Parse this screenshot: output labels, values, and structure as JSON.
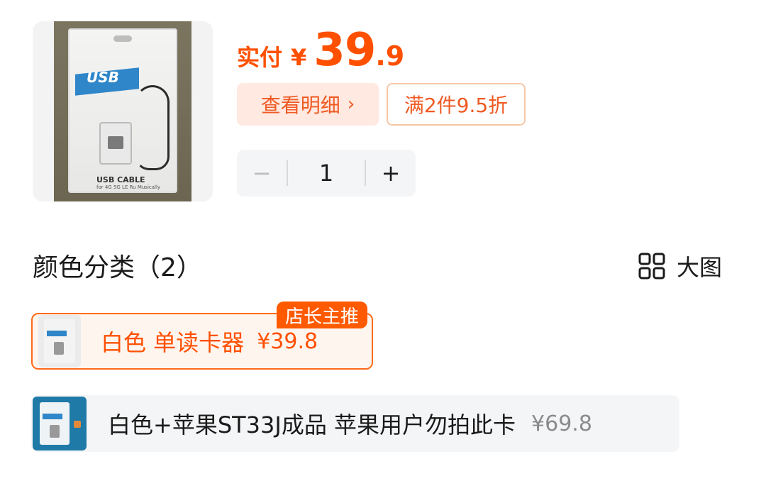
{
  "product": {
    "image_alt": "USB card reader in clear pouch",
    "pouch_text": "USB",
    "pouch_caption": "USB CABLE",
    "pouch_caption_sub": "for 4G 5G LE Ru Musically"
  },
  "price": {
    "label": "实付",
    "symbol": "¥",
    "integer": "39",
    "decimal": ".9"
  },
  "detail_button": {
    "label": "查看明细",
    "chevron": "›"
  },
  "discount_tag": "满2件9.5折",
  "quantity": {
    "minus": "−",
    "value": "1",
    "plus": "+"
  },
  "variants_section": {
    "title": "颜色分类（2）",
    "view_toggle_label": "大图"
  },
  "variants": [
    {
      "name": "白色 单读卡器",
      "price": "¥39.8",
      "badge": "店长主推",
      "selected": true
    },
    {
      "name": "白色+苹果ST33J成品 苹果用户勿拍此卡",
      "price": "¥69.8",
      "selected": false
    }
  ],
  "colors": {
    "accent": "#ff5000",
    "accent_light": "#ffe9e0",
    "option_bg": "#f4f5f7",
    "text": "#1a1a1a",
    "muted": "#8a8a8a"
  },
  "icons": {
    "view_toggle": "grid-icon"
  }
}
